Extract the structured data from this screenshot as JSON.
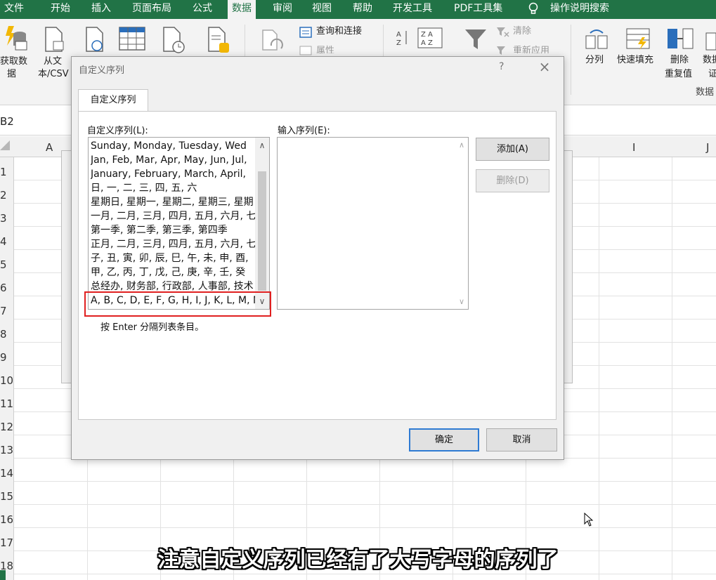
{
  "ribbon_tabs": [
    "文件",
    "开始",
    "插入",
    "页面布局",
    "公式",
    "数据",
    "审阅",
    "视图",
    "帮助",
    "开发工具",
    "PDF工具集",
    "操作说明搜索"
  ],
  "active_tab": "数据",
  "ribbon": {
    "get_data": "获取数",
    "get_data_2": "据",
    "from_text": "从文",
    "from_text_2": "本/CSV",
    "query_connect": "查询和连接",
    "properties": "属性",
    "clear": "清除",
    "reapply": "重新应用",
    "split": "分列",
    "flash_fill": "快速填充",
    "remove_dup": "删除",
    "remove_dup_2": "重复值",
    "data_valid": "数据",
    "data_valid_2": "证",
    "data_tools_group": "数据"
  },
  "name_box": "B2",
  "columns": [
    "A",
    "I",
    "J"
  ],
  "rows": [
    "1",
    "2",
    "3",
    "4",
    "5",
    "6",
    "7",
    "8",
    "9",
    "10",
    "11",
    "12",
    "13",
    "14",
    "15",
    "16",
    "17",
    "18"
  ],
  "dialog": {
    "title": "自定义序列",
    "help": "?",
    "close": "×",
    "tab": "自定义序列",
    "list_label": "自定义序列(L):",
    "input_label": "输入序列(E):",
    "lists": [
      "Sunday, Monday, Tuesday, Wed",
      "Jan, Feb, Mar, Apr, May, Jun, Jul,",
      "January, February, March, April,",
      "日, 一, 二, 三, 四, 五, 六",
      "星期日, 星期一, 星期二, 星期三, 星期",
      "一月, 二月, 三月, 四月, 五月, 六月, 七",
      "第一季, 第二季, 第三季, 第四季",
      "正月, 二月, 三月, 四月, 五月, 六月, 七",
      "子, 丑, 寅, 卯, 辰, 巳, 午, 未, 申, 酉,",
      "甲, 乙, 丙, 丁, 戊, 己, 庚, 辛, 壬, 癸",
      "总经办, 财务部, 行政部, 人事部, 技术",
      "A, B, C, D, E, F, G, H, I, J, K, L, M, N"
    ],
    "hint": "按 Enter 分隔列表条目。",
    "add_button": "添加(A)",
    "delete_button": "删除(D)",
    "ok_button": "确定",
    "cancel_button": "取消"
  },
  "caption": "注意自定义序列已经有了大写字母的序列了"
}
